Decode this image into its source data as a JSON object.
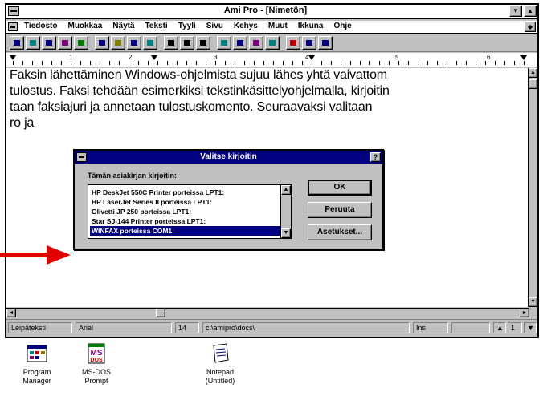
{
  "window": {
    "title": "Ami Pro - [Nimetön]",
    "minimize_glyph": "▼",
    "maximize_glyph": "▲",
    "restore_glyph": "◆"
  },
  "menu": {
    "items": [
      "Tiedosto",
      "Muokkaa",
      "Näytä",
      "Teksti",
      "Tyyli",
      "Sivu",
      "Kehys",
      "Muut",
      "Ikkuna",
      "Ohje"
    ]
  },
  "toolbar": {
    "icons": [
      "new-document-icon",
      "open-file-icon",
      "print-icon",
      "print-preview-icon",
      "save-icon",
      "cut-icon",
      "copy-icon",
      "paste-icon",
      "undo-icon",
      "bold-icon",
      "italic-icon",
      "underline-icon",
      "frame-icon",
      "table-icon",
      "chart-icon",
      "drawing-icon",
      "spell-check-icon",
      "styles-icon",
      "help-icon"
    ],
    "colors": [
      "#000080",
      "#008080",
      "#000080",
      "#800080",
      "#008000",
      "#000080",
      "#808000",
      "#000080",
      "#008080",
      "#000000",
      "#000000",
      "#000000",
      "#008080",
      "#000080",
      "#800080",
      "#008080",
      "#c00000",
      "#000080",
      "#000080"
    ]
  },
  "ruler": {
    "numbers": [
      "1",
      "2",
      "3",
      "4",
      "5",
      "6"
    ]
  },
  "document": {
    "lines": [
      "Faksin lähettäminen Windows-ohjelmista sujuu lähes yhtä vaivattom",
      "tulostus. Faksi tehdään esimerkiksi tekstinkäsittelyohjelmalla, kirjoitin",
      "taan faksiajuri ja annetaan tulostuskomento. Seuraavaksi valitaan",
      "ro ja"
    ]
  },
  "dialog": {
    "title": "Valitse kirjoitin",
    "help_glyph": "?",
    "list_label": "Tämän asiakirjan kirjoitin:",
    "printers": [
      "HP DeskJet 550C Printer porteissa LPT1:",
      "HP LaserJet Series II porteissa LPT1:",
      "Olivetti JP 250 porteissa LPT1:",
      "Star SJ-144 Printer porteissa LPT1:",
      "WINFAX porteissa COM1:"
    ],
    "selected_index": 4,
    "buttons": {
      "ok": "OK",
      "cancel": "Peruuta",
      "setup": "Asetukset..."
    }
  },
  "status_bar": {
    "style": "Leipäteksti",
    "font": "Arial",
    "size": "14",
    "path": "c:\\amipro\\docs\\",
    "mode": "Ins",
    "page": "1"
  },
  "desktop": {
    "icons": [
      {
        "label": "Program Manager",
        "icon": "program-manager-icon"
      },
      {
        "label": "MS-DOS Prompt",
        "icon": "ms-dos-prompt-icon"
      },
      {
        "label": "Notepad (Untitled)",
        "icon": "notepad-icon"
      }
    ]
  },
  "accent_colors": {
    "dialog_titlebar": "#000080",
    "selection": "#000080",
    "pointer_arrow": "#e00000"
  }
}
